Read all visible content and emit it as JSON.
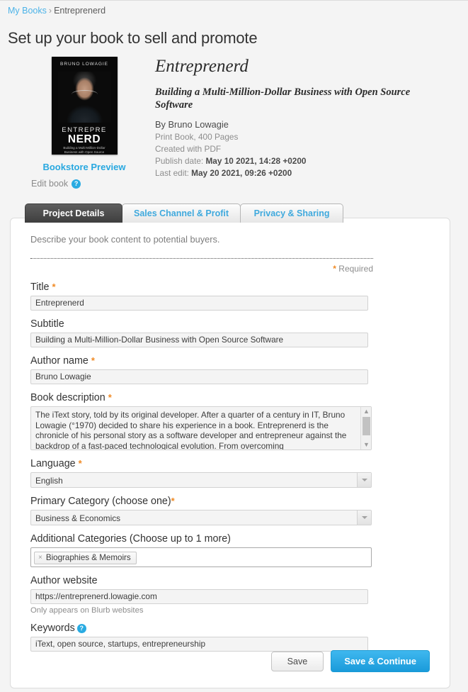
{
  "breadcrumb": {
    "root": "My Books",
    "separator": "›",
    "current": "Entreprenerd"
  },
  "page_title": "Set up your book to sell and promote",
  "cover": {
    "author_top": "BRUNO LOWAGIE",
    "title_line1": "ENTREPRE",
    "title_line2": "NERD",
    "subtitle": "Building a Multi-Million-Dollar Business with Open Source Software",
    "preview_link": "Bookstore Preview",
    "edit_label": "Edit book",
    "help_glyph": "?"
  },
  "book": {
    "title": "Entreprenerd",
    "subtitle": "Building a Multi-Million-Dollar Business with Open Source Software",
    "by_line": "By Bruno Lowagie",
    "format": "Print Book, 400 Pages",
    "created_with": "Created with PDF",
    "publish_label": "Publish date: ",
    "publish_value": "May 10 2021, 14:28 +0200",
    "last_edit_label": "Last edit: ",
    "last_edit_value": "May 20 2021, 09:26 +0200"
  },
  "tabs": [
    {
      "label": "Project Details",
      "active": true
    },
    {
      "label": "Sales Channel & Profit",
      "active": false
    },
    {
      "label": "Privacy & Sharing",
      "active": false
    }
  ],
  "form": {
    "describe": "Describe your book content to potential buyers.",
    "required_note": "Required",
    "asterisk": "*",
    "title": {
      "label": "Title",
      "value": "Entreprenerd",
      "required": true
    },
    "subtitle": {
      "label": "Subtitle",
      "value": "Building a Multi-Million-Dollar Business with Open Source Software",
      "required": false
    },
    "author_name": {
      "label": "Author name",
      "value": "Bruno Lowagie",
      "required": true
    },
    "description": {
      "label": "Book description",
      "required": true,
      "value": "The iText story, told by its original developer. After a quarter of a century in IT, Bruno Lowagie (°1970) decided to share his experience in a book. Entreprenerd is the chronicle of his personal story as a software developer and entrepreneur against the backdrop of a fast-paced technological evolution. From overcoming"
    },
    "language": {
      "label": "Language",
      "value": "English",
      "required": true
    },
    "primary_category": {
      "label": "Primary Category (choose one)",
      "value": "Business & Economics",
      "required": true
    },
    "additional_categories": {
      "label": "Additional Categories (Choose up to 1 more)",
      "tags": [
        "Biographies & Memoirs"
      ],
      "remove_glyph": "×"
    },
    "author_website": {
      "label": "Author website",
      "value": "https://entreprenerd.lowagie.com",
      "hint": "Only appears on Blurb websites"
    },
    "keywords": {
      "label": "Keywords",
      "value": "iText, open source, startups, entrepreneurship",
      "help_glyph": "?"
    }
  },
  "buttons": {
    "save": "Save",
    "save_continue": "Save & Continue"
  },
  "colors": {
    "link": "#4cb3e8",
    "accent": "#29abe2",
    "required": "#f08a24",
    "tab_active_bg": "#4e4e4e"
  }
}
